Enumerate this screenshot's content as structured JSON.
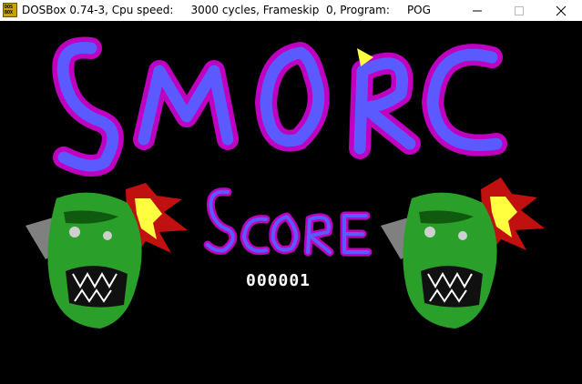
{
  "window": {
    "title": "DOSBox 0.74-3, Cpu speed:     3000 cycles, Frameskip  0, Program:     POG",
    "app_icon_text_1": "DOS",
    "app_icon_text_2": "BOX"
  },
  "game": {
    "title_logo": "SMORC",
    "score_label": "SCORE",
    "score_value": "000001"
  },
  "colors": {
    "background": "#000000",
    "logo_fill": "#5a5aff",
    "logo_outline": "#c000c0",
    "orc_green": "#2aa02a",
    "explosion_red": "#c01010",
    "explosion_yellow": "#ffff40"
  }
}
